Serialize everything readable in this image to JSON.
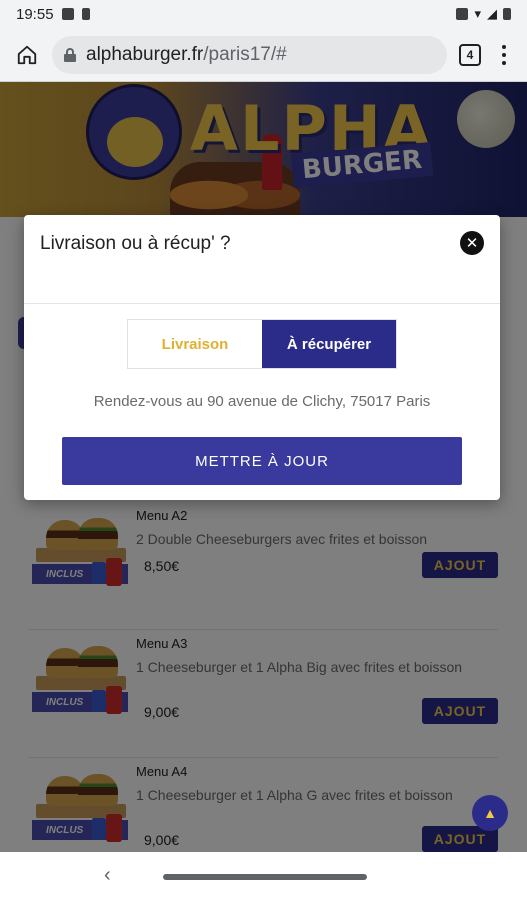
{
  "status_bar": {
    "time": "19:55"
  },
  "browser": {
    "url_domain": "alphaburger.fr",
    "url_path": "/paris17/#",
    "tab_count": "4"
  },
  "banner": {
    "logo_main": "ALPHA",
    "logo_sub": "BURGER"
  },
  "modal": {
    "title": "Livraison ou à récup' ?",
    "close_symbol": "✕",
    "option_delivery": "Livraison",
    "option_pickup": "À récupérer",
    "selected_option": "À récupérer",
    "address": "Rendez-vous au 90 avenue de Clichy, 75017 Paris",
    "update_label": "METTRE À JOUR"
  },
  "menu_items": [
    {
      "name": "Menu A2",
      "desc": "2 Double Cheeseburgers avec frites et boisson",
      "price": "8,50€",
      "badge": "INCLUS",
      "add_label": "AJOUT"
    },
    {
      "name": "Menu A3",
      "desc": "1 Cheeseburger et 1 Alpha Big avec frites et boisson",
      "price": "9,00€",
      "badge": "INCLUS",
      "add_label": "AJOUT"
    },
    {
      "name": "Menu A4",
      "desc": "1  Cheeseburger et 1 Alpha G avec frites et boisson",
      "price": "9,00€",
      "badge": "INCLUS",
      "add_label": "AJOUT"
    }
  ],
  "icons": {
    "home": "home-icon",
    "lock": "lock-icon",
    "menu": "more-vert-icon",
    "close": "close-icon",
    "scroll_top": "chevron-up-icon",
    "back": "back-icon"
  },
  "colors": {
    "brand_blue": "#2b2c8a",
    "brand_yellow": "#f2c84b",
    "button_blue": "#3a3a9e"
  }
}
